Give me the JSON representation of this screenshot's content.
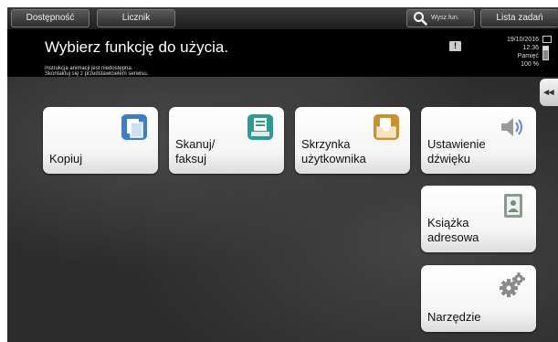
{
  "topbar": {
    "accessibility_label": "Dostępność",
    "counter_label": "Licznik",
    "search_label": "Wysz.fun.",
    "job_list_label": "Lista zadań"
  },
  "header": {
    "title": "Wybierz funkcję do użycia.",
    "info_line1": "Instrukcja animacji jest niedostępna.",
    "info_line2": "Skontaktuj się z przedstawicielem serwisu.",
    "date": "19/10/2016",
    "time": "12:36",
    "memory_label": "Pamięć",
    "memory_value": "100 %"
  },
  "tiles": {
    "copy": {
      "label": "Kopiuj",
      "icon": "copy-icon",
      "color": "#3e7fc4"
    },
    "scan": {
      "line1": "Skanuj/",
      "line2": "faksuj",
      "icon": "scan-fax-icon",
      "color": "#2f9a8f"
    },
    "box": {
      "line1": "Skrzynka",
      "line2": "użytkownika",
      "icon": "user-box-icon",
      "color": "#c9922c"
    },
    "sound": {
      "line1": "Ustawienie",
      "line2": "dźwięku",
      "icon": "speaker-icon",
      "color": "#5a8fc8"
    },
    "address": {
      "line1": "Książka",
      "line2": "adresowa",
      "icon": "address-book-icon",
      "color": "#7a8a80"
    },
    "utility": {
      "label": "Narzędzie",
      "icon": "gear-icon",
      "color": "#8a8a8a"
    }
  }
}
